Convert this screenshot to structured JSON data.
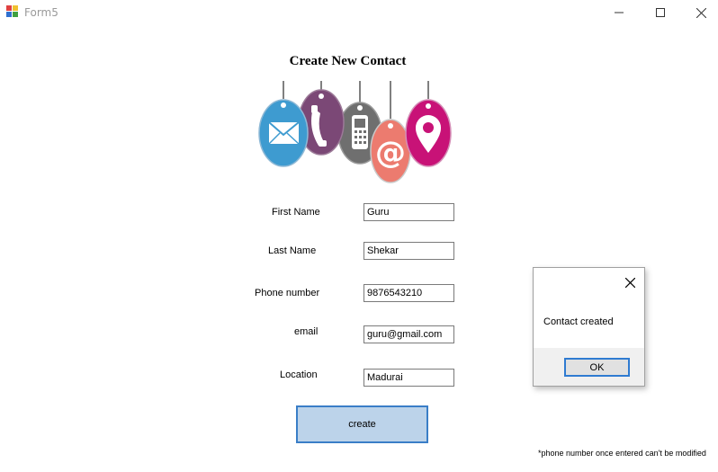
{
  "window": {
    "title": "Form5",
    "buttons": [
      "minimize",
      "maximize",
      "close"
    ]
  },
  "form": {
    "heading": "Create New Contact",
    "hero_icons": [
      "mail-icon",
      "phone-handset-icon",
      "mobile-phone-icon",
      "at-sign-icon",
      "location-pin-icon"
    ],
    "fields": [
      {
        "label": "First Name",
        "value": "Guru"
      },
      {
        "label": "Last Name",
        "value": "Shekar"
      },
      {
        "label": "Phone number",
        "value": "9876543210"
      },
      {
        "label": "email",
        "value": "guru@gmail.com"
      },
      {
        "label": "Location",
        "value": "Madurai"
      }
    ],
    "create_label": "create",
    "footnote": "*phone number once entered can't be modified"
  },
  "dialog": {
    "message": "Contact created",
    "ok_label": "OK"
  },
  "colors": {
    "mail_tag": "#3e9bd0",
    "phone_tag": "#7b4876",
    "mobile_tag": "#6f6f6f",
    "at_tag": "#ec7b6f",
    "location_tag": "#c81277",
    "button_fill": "#bcd3ea",
    "button_border": "#3a7ec7"
  }
}
